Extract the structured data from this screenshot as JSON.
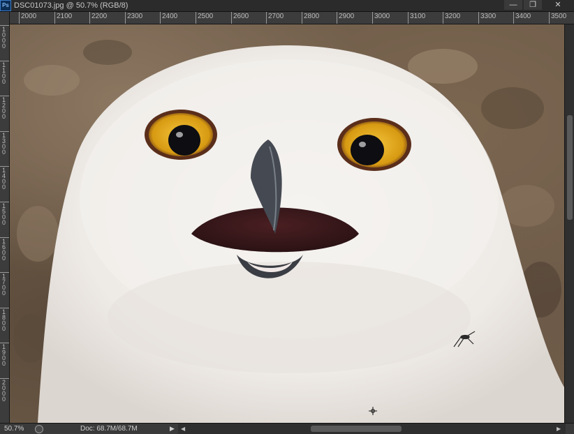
{
  "app": {
    "logo": "Ps",
    "doc_title": "DSC01073.jpg @ 50.7% (RGB/8)"
  },
  "window_controls": {
    "minimize": "—",
    "maximize": "❐",
    "close": "✕"
  },
  "ruler_h": [
    "2000",
    "2100",
    "2200",
    "2300",
    "2400",
    "2500",
    "2600",
    "2700",
    "2800",
    "2900",
    "3000",
    "3100",
    "3200",
    "3300",
    "3400",
    "3500"
  ],
  "ruler_v": [
    "1000",
    "1100",
    "1200",
    "1300",
    "1400",
    "1500",
    "1600",
    "1700",
    "1800",
    "1900",
    "2000"
  ],
  "status": {
    "zoom": "50.7%",
    "doc_info": "Doc: 68.7M/68.7M",
    "arrow": "▶"
  },
  "scroll_arrows": {
    "left": "◀",
    "right": "▶"
  },
  "colors": {
    "ui_bg": "#2b2b2b",
    "ruler_bg": "#3c3c3c",
    "owl_white": "#f3f1ee",
    "eye_yellow": "#e1a51b",
    "background_rock": "#6e5c49"
  }
}
